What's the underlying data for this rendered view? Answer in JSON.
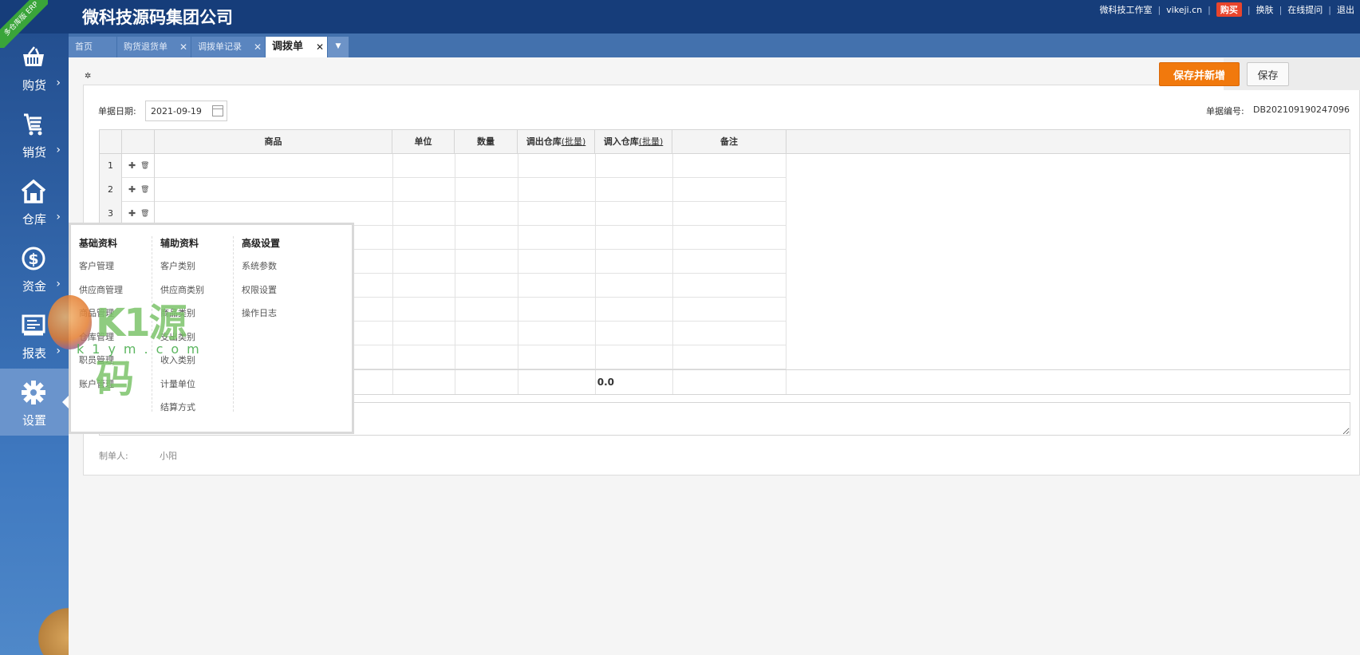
{
  "header": {
    "company": "微科技源码集团公司",
    "ribbon": "多仓库版 ERP",
    "links": [
      "微科技工作室",
      "vikeji.cn"
    ],
    "buy": "购买",
    "links2": [
      "换肤",
      "在线提问",
      "退出"
    ]
  },
  "sidebar": {
    "items": [
      {
        "label": "购货",
        "icon": "basket-icon"
      },
      {
        "label": "销货",
        "icon": "cart-icon"
      },
      {
        "label": "仓库",
        "icon": "warehouse-icon"
      },
      {
        "label": "资金",
        "icon": "dollar-icon"
      },
      {
        "label": "报表",
        "icon": "report-icon"
      },
      {
        "label": "设置",
        "icon": "gear-icon"
      }
    ]
  },
  "tabs": [
    {
      "label": "首页"
    },
    {
      "label": "购货退货单"
    },
    {
      "label": "调拨单记录"
    },
    {
      "label": "调拨单"
    }
  ],
  "toolbar": {
    "save_new": "保存并新增",
    "save": "保存"
  },
  "form": {
    "date_label": "单据日期:",
    "date_value": "2021-09-19",
    "docno_label": "单据编号:",
    "docno_value": "DB202109190247096"
  },
  "grid": {
    "headers": {
      "goods": "商品",
      "unit": "单位",
      "qty": "数量",
      "out_wh": "调出仓库",
      "in_wh": "调入仓库",
      "batch": "(批量)",
      "remark": "备注"
    },
    "rows": [
      "1",
      "2",
      "3"
    ],
    "total_qty": "0.0"
  },
  "footer": {
    "maker_label": "制单人:",
    "maker_value": "小阳"
  },
  "popup": {
    "basic": {
      "title": "基础资料",
      "items": [
        "客户管理",
        "供应商管理",
        "商品管理",
        "仓库管理",
        "职员管理",
        "账户管理"
      ]
    },
    "aux": {
      "title": "辅助资料",
      "items": [
        "客户类别",
        "供应商类别",
        "商品类别",
        "支出类别",
        "收入类别",
        "计量单位",
        "结算方式"
      ]
    },
    "adv": {
      "title": "高级设置",
      "items": [
        "系统参数",
        "权限设置",
        "操作日志"
      ]
    }
  },
  "watermark": {
    "main": "K1源码",
    "sub": "k1ym.com"
  },
  "colors": {
    "header": "#163d7a",
    "accent": "#f1790d",
    "tabbar": "#4371ad"
  }
}
